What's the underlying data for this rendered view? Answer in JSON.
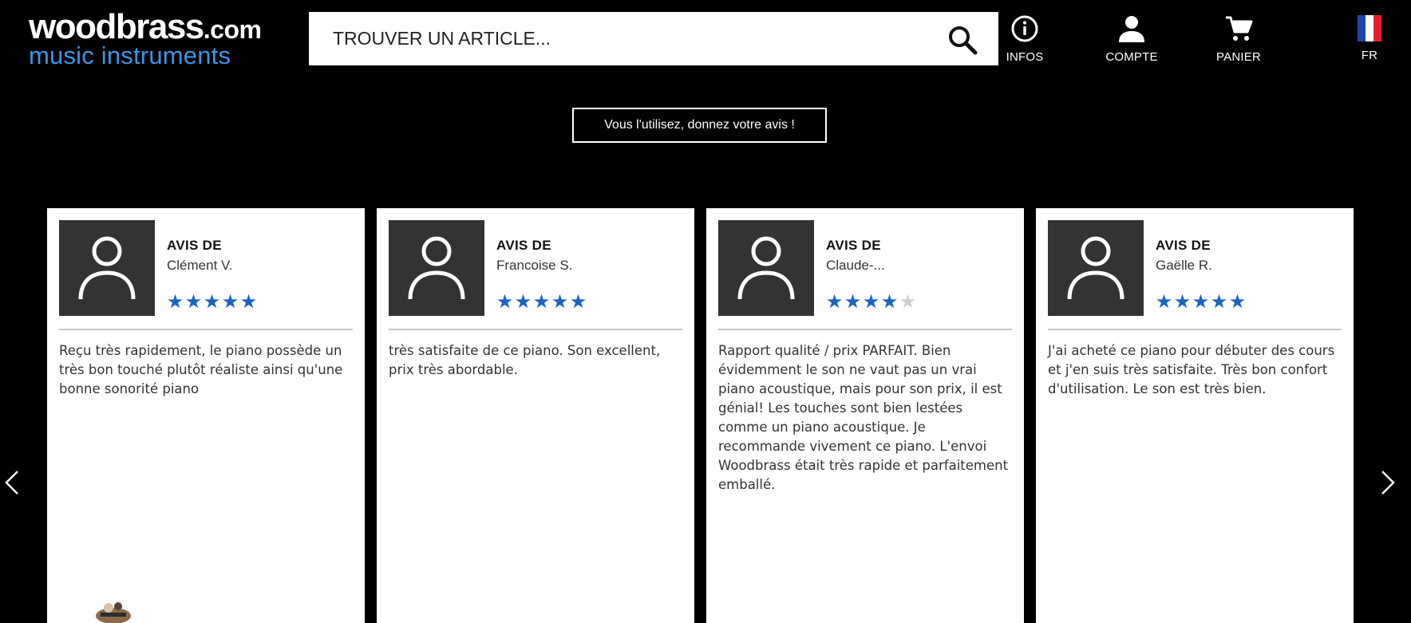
{
  "header": {
    "logo": {
      "line1": "woodbrass",
      "line1_suffix": ".com",
      "line2": "music instruments"
    },
    "search": {
      "placeholder": "TROUVER UN ARTICLE...",
      "icon": "search-icon"
    },
    "nav": [
      {
        "label": "INFOS",
        "icon": "info-icon"
      },
      {
        "label": "COMPTE",
        "icon": "user-icon"
      },
      {
        "label": "PANIER",
        "icon": "cart-icon"
      },
      {
        "label": "FR",
        "icon": "french-flag-icon"
      }
    ]
  },
  "cta": {
    "label": "Vous l'utilisez, donnez votre avis !"
  },
  "carousel": {
    "prev_icon": "chevron-left-icon",
    "next_icon": "chevron-right-icon",
    "reviews": [
      {
        "heading": "AVIS DE",
        "author": "Clément V.",
        "rating": 5,
        "max_rating": 5,
        "text": "Reçu très rapidement, le piano possède un très bon touché plutôt réaliste ainsi qu'une bonne sonorité piano"
      },
      {
        "heading": "AVIS DE",
        "author": "Francoise S.",
        "rating": 5,
        "max_rating": 5,
        "text": "très satisfaite de ce piano. Son excellent, prix très abordable."
      },
      {
        "heading": "AVIS DE",
        "author": "Claude-...",
        "rating": 4,
        "max_rating": 5,
        "text": "Rapport qualité / prix PARFAIT. Bien évidemment le son ne vaut pas un vrai piano acoustique, mais pour son prix, il est génial! Les touches sont bien lestées comme un piano acoustique. Je recommande vivement ce piano. L'envoi Woodbrass était très rapide et parfaitement emballé."
      },
      {
        "heading": "AVIS DE",
        "author": "Gaëlle R.",
        "rating": 5,
        "max_rating": 5,
        "text": "J'ai acheté ce piano pour débuter des cours et j'en suis très satisfaite. Très bon confort d'utilisation. Le son est très bien."
      }
    ]
  },
  "colors": {
    "background": "#000000",
    "logo_accent": "#3a95e6",
    "star": "#1a64c2",
    "star_empty": "#cfcfcf",
    "avatar_bg": "#333333"
  }
}
